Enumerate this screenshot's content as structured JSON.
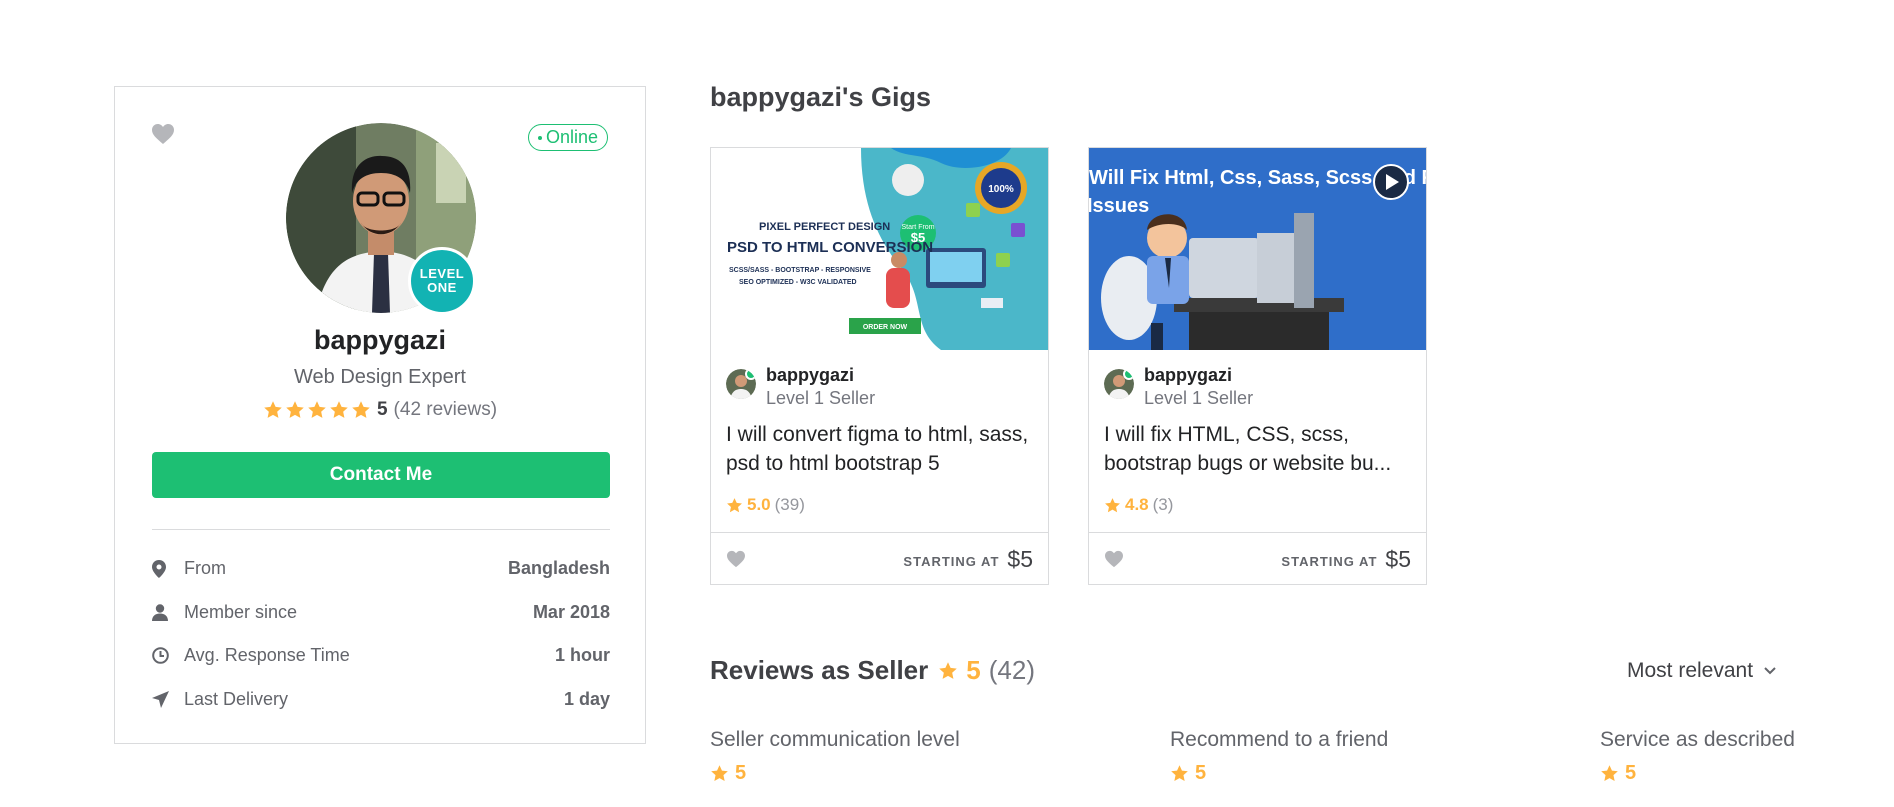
{
  "profile": {
    "online_label": "Online",
    "level_badge": [
      "LEVEL",
      "ONE"
    ],
    "username": "bappygazi",
    "tagline": "Web Design Expert",
    "rating": "5",
    "reviews": "(42 reviews)",
    "contact_label": "Contact Me",
    "stats": [
      {
        "icon": "location-pin-icon",
        "label": "From",
        "value": "Bangladesh"
      },
      {
        "icon": "user-icon",
        "label": "Member since",
        "value": "Mar 2018"
      },
      {
        "icon": "clock-icon",
        "label": "Avg. Response Time",
        "value": "1 hour"
      },
      {
        "icon": "send-icon",
        "label": "Last Delivery",
        "value": "1 day"
      }
    ]
  },
  "gigs": {
    "title": "bappygazi's Gigs",
    "items": [
      {
        "seller": "bappygazi",
        "level": "Level 1 Seller",
        "description": "I will convert figma to html, sass, psd to html bootstrap 5",
        "rating": "5.0",
        "count": "(39)",
        "starting_at": "STARTING AT",
        "price": "$5",
        "thumb": {
          "line1": "PIXEL PERFECT DESIGN",
          "line2": "PSD TO HTML CONVERSION",
          "line3": "SCSS/SASS - BOOTSTRAP - RESPONSIVE",
          "line4": "SEO OPTIMIZED - W3C VALIDATED",
          "order": "ORDER NOW",
          "start_from": "Start From",
          "start_price": "$5",
          "guarantee": "100%"
        }
      },
      {
        "seller": "bappygazi",
        "level": "Level 1 Seller",
        "description": "I will fix HTML, CSS, scss, bootstrap bugs or website bu...",
        "rating": "4.8",
        "count": "(3)",
        "starting_at": "STARTING AT",
        "price": "$5",
        "thumb": {
          "line1": "Will Fix Html, Css, Sass, Scss And Responsive",
          "line2": "Issues"
        }
      }
    ]
  },
  "reviews": {
    "title": "Reviews as Seller",
    "score": "5",
    "count": "(42)",
    "sort_label": "Most relevant",
    "breakdown": [
      {
        "label": "Seller communication level",
        "value": "5"
      },
      {
        "label": "Recommend to a friend",
        "value": "5"
      },
      {
        "label": "Service as described",
        "value": "5"
      }
    ]
  },
  "colors": {
    "brand": "#1dbf73",
    "star": "#ffb33e",
    "badge": "#12b3b3"
  }
}
